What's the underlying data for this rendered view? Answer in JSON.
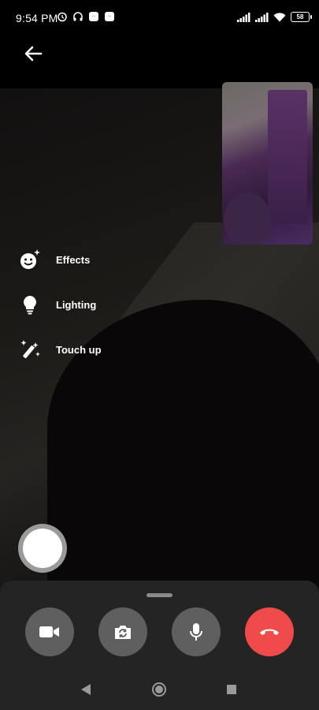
{
  "status_bar": {
    "time": "9:54 PM",
    "battery": "58",
    "icons": [
      "alarm-icon",
      "headphones-icon",
      "messenger-icon",
      "messenger-icon",
      "signal-icon",
      "signal-icon",
      "wifi-icon",
      "battery-icon"
    ]
  },
  "menu": {
    "effects_label": "Effects",
    "lighting_label": "Lighting",
    "touchup_label": "Touch up"
  },
  "controls": [
    "camera-icon",
    "flip-camera-icon",
    "microphone-icon",
    "end-call-icon"
  ],
  "colors": {
    "end_call": "#f04a4a",
    "control_bg": "#5f5f5f",
    "sheet_bg": "#242424"
  }
}
